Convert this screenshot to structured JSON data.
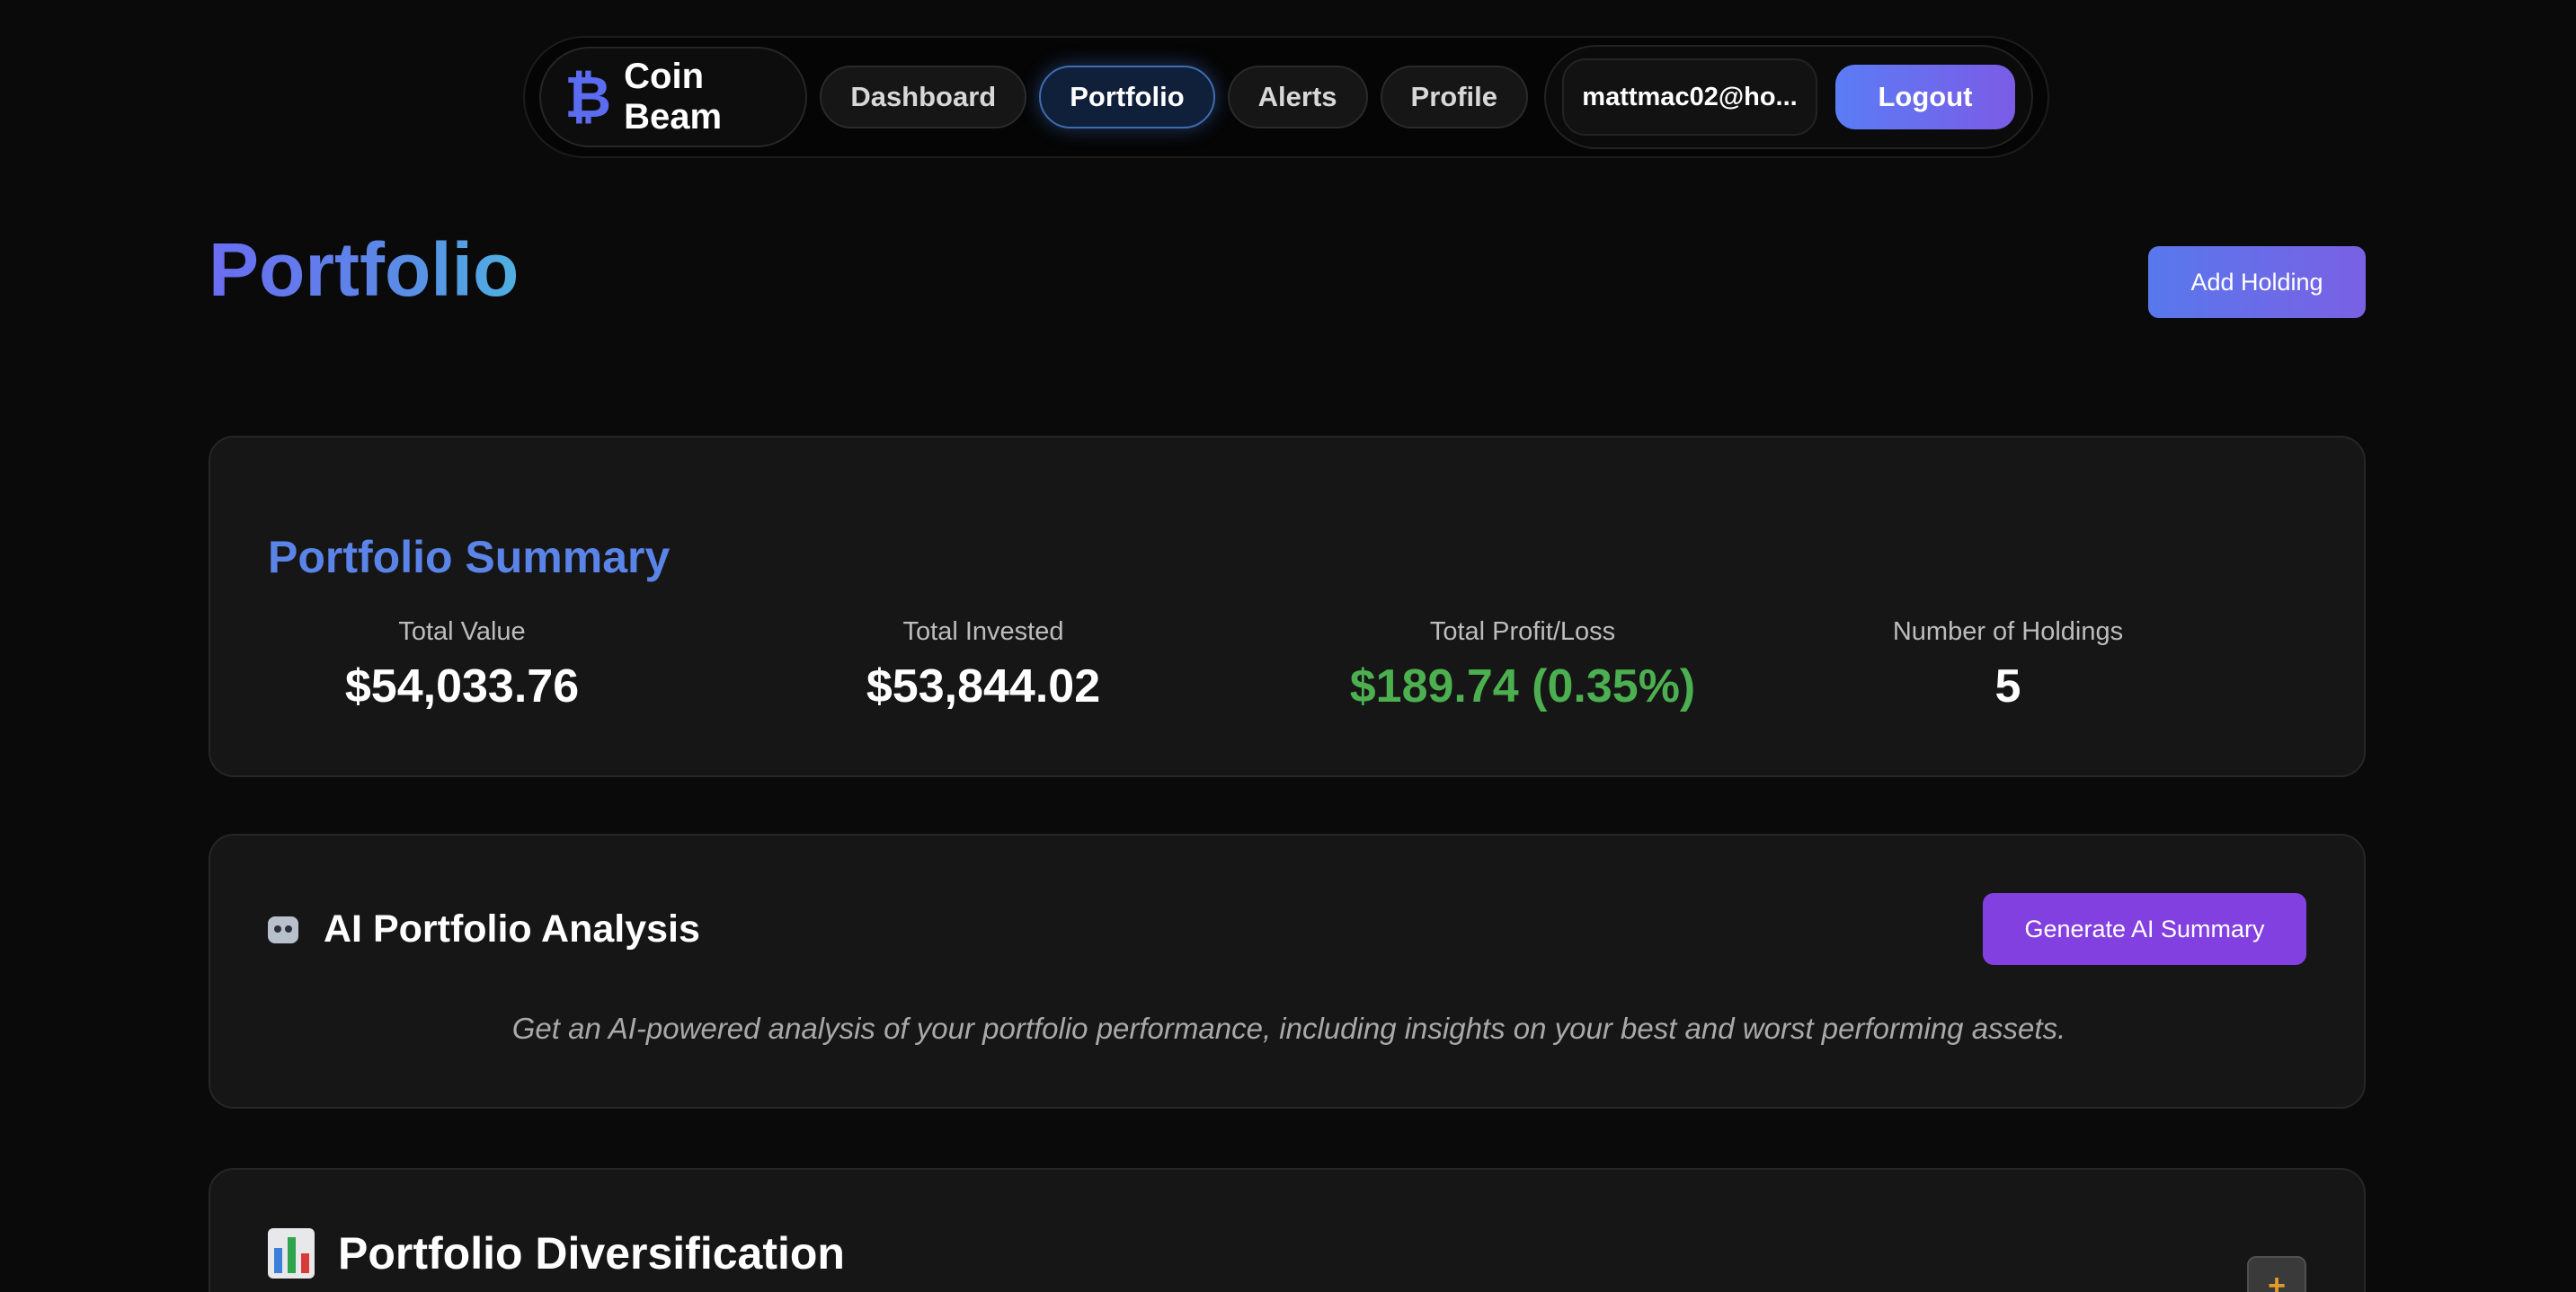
{
  "nav": {
    "brand_icon": "₿",
    "brand_name": "Coin Beam",
    "items": [
      {
        "label": "Dashboard",
        "active": false
      },
      {
        "label": "Portfolio",
        "active": true
      },
      {
        "label": "Alerts",
        "active": false
      },
      {
        "label": "Profile",
        "active": false
      }
    ],
    "user_email": "mattmac02@ho...",
    "logout_label": "Logout"
  },
  "header": {
    "title": "Portfolio",
    "add_holding_label": "Add Holding"
  },
  "summary": {
    "title": "Portfolio Summary",
    "stats": [
      {
        "label": "Total Value",
        "value": "$54,033.76"
      },
      {
        "label": "Total Invested",
        "value": "$53,844.02"
      },
      {
        "label": "Total Profit/Loss",
        "value": "$189.74 (0.35%)"
      },
      {
        "label": "Number of Holdings",
        "value": "5"
      }
    ]
  },
  "ai": {
    "title": "AI Portfolio Analysis",
    "icon": "robot-icon",
    "button_label": "Generate AI Summary",
    "description": "Get an AI-powered analysis of your portfolio performance, including insights on your best and worst performing assets."
  },
  "diversification": {
    "title": "Portfolio Diversification",
    "icon": "bar-chart-icon",
    "add_label": "+"
  },
  "colors": {
    "accent": "#5b84e8",
    "positive": "#4caf50",
    "ai_button": "#8340e0"
  }
}
